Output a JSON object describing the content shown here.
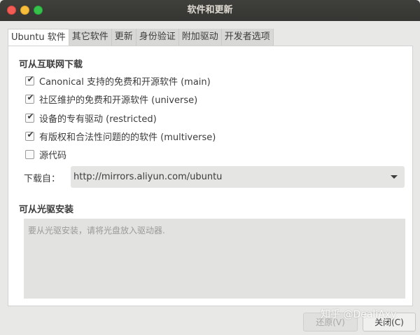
{
  "window": {
    "title": "软件和更新"
  },
  "tabs": [
    {
      "label": "Ubuntu 软件",
      "active": true
    },
    {
      "label": "其它软件",
      "active": false
    },
    {
      "label": "更新",
      "active": false
    },
    {
      "label": "身份验证",
      "active": false
    },
    {
      "label": "附加驱动",
      "active": false
    },
    {
      "label": "开发者选项",
      "active": false
    }
  ],
  "internet": {
    "section_title": "可从互联网下载",
    "options": [
      {
        "label": "Canonical 支持的免费和开源软件 (main)",
        "checked": true
      },
      {
        "label": "社区维护的免费和开源软件 (universe)",
        "checked": true
      },
      {
        "label": "设备的专有驱动 (restricted)",
        "checked": true
      },
      {
        "label": "有版权和合法性问题的的软件 (multiverse)",
        "checked": true
      },
      {
        "label": "源代码",
        "checked": false
      }
    ],
    "download_from_label": "下载自：",
    "download_from_value": "http://mirrors.aliyun.com/ubuntu"
  },
  "cdrom": {
    "section_title": "可从光驱安装",
    "placeholder": "要从光驱安装，请将光盘放入驱动器."
  },
  "buttons": {
    "revert_label": "还原(V)",
    "close_label": "关闭(C)"
  },
  "watermark": "知乎 @DealiAxy",
  "colors": {
    "titlebar": "#3a3a37",
    "window_bg": "#e8e8e7",
    "close_dot": "#f25c55",
    "minimize_dot": "#f6be3a",
    "maximize_dot": "#35c14a"
  }
}
